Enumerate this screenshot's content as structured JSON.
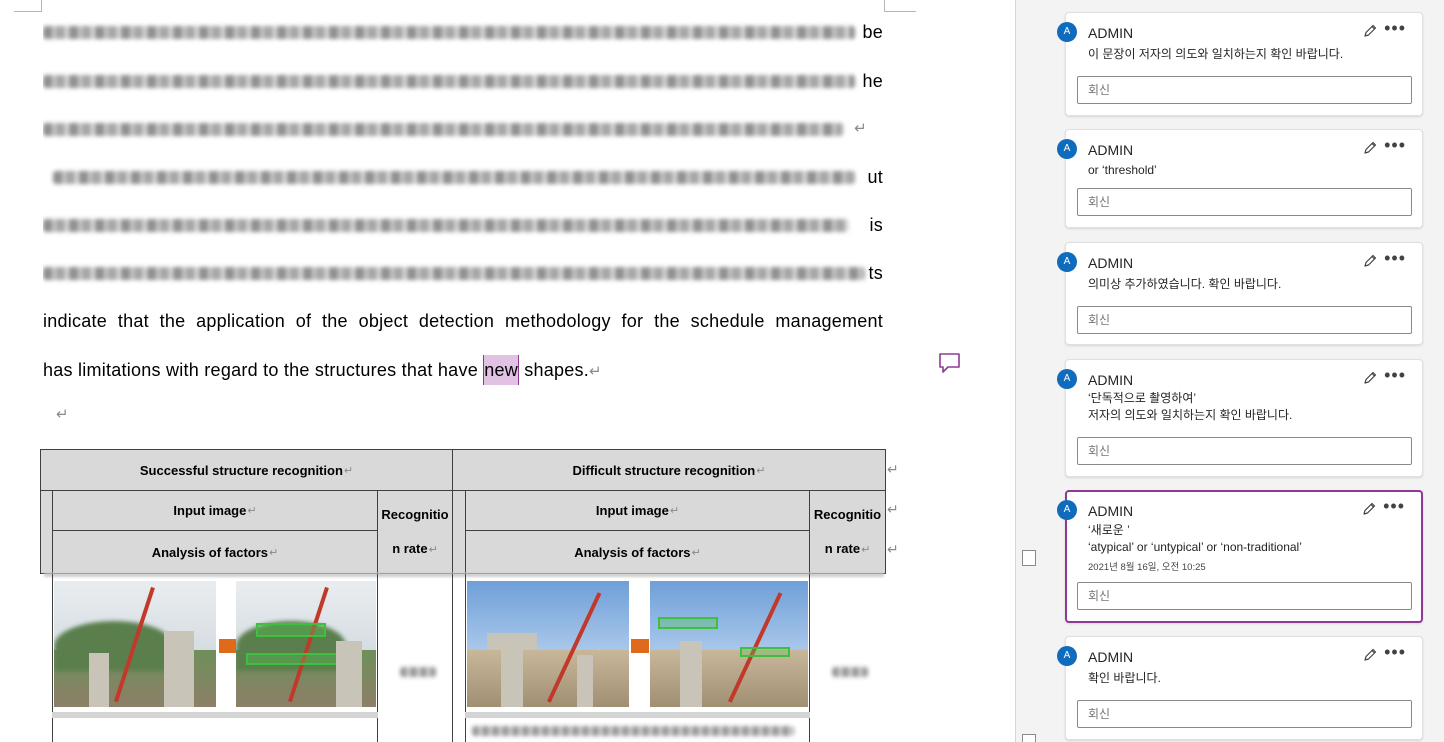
{
  "document": {
    "lines": [
      {
        "tail": "be"
      },
      {
        "tail": "he"
      },
      {
        "tail": "↵"
      },
      {
        "tail": "ut"
      },
      {
        "tail": "is"
      },
      {
        "tail": "ts"
      }
    ],
    "line7": "indicate that the application of the object detection methodology for the schedule management",
    "line8_before": "has limitations with regard to the structures that have ",
    "line8_highlight": "new",
    "line8_after": " shapes.",
    "para_mark": "↵"
  },
  "table": {
    "header_left": "Successful structure recognition",
    "header_right": "Difficult structure recognition",
    "input_image": "Input image",
    "analysis_of_factors": "Analysis of factors",
    "recognition_1": "Recognitio",
    "recognition_2": "n rate",
    "para_mark": "↵"
  },
  "comments": [
    {
      "author": "ADMIN",
      "avatar": "A",
      "lines": [
        "이 문장이 저자의 의도와 일치하는지 확인 바랍니다."
      ],
      "reply_placeholder": "회신"
    },
    {
      "author": "ADMIN",
      "avatar": "A",
      "lines": [
        "or ‘threshold’"
      ],
      "reply_placeholder": "회신"
    },
    {
      "author": "ADMIN",
      "avatar": "A",
      "lines": [
        "의미상 추가하였습니다. 확인 바랍니다."
      ],
      "reply_placeholder": "회신"
    },
    {
      "author": "ADMIN",
      "avatar": "A",
      "lines": [
        "‘단독적으로 촬영하여’",
        "저자의 의도와 일치하는지 확인 바랍니다."
      ],
      "reply_placeholder": "회신"
    },
    {
      "author": "ADMIN",
      "avatar": "A",
      "lines": [
        "‘새로운 ’",
        "‘atypical’ or ‘untypical’ or ‘non-traditional’"
      ],
      "date": "2021년 8월 16일, 오전 10:25",
      "reply_placeholder": "회신",
      "active": true
    },
    {
      "author": "ADMIN",
      "avatar": "A",
      "lines": [
        "확인 바랍니다."
      ],
      "reply_placeholder": "회신"
    }
  ],
  "icons": {
    "edit": "pencil-icon",
    "more": "more-options-icon",
    "comment": "comment-icon"
  },
  "colors": {
    "accent": "#8e3a95",
    "highlight": "#e2c2e3",
    "avatar": "#0f6cbd",
    "table_header": "#d9d9d9"
  }
}
